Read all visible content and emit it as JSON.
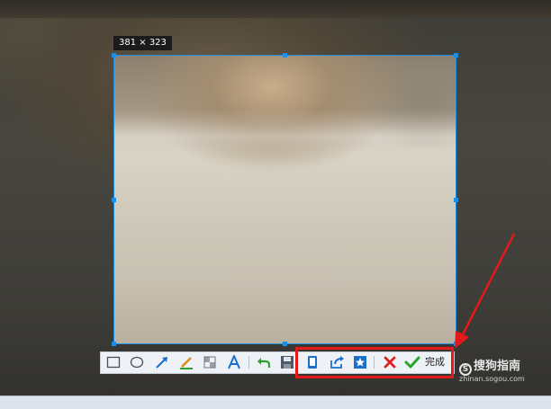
{
  "selection": {
    "size_label": "381 × 323"
  },
  "toolbar": {
    "tools": [
      {
        "name": "rectangle-tool",
        "icon": "rectangle-icon"
      },
      {
        "name": "ellipse-tool",
        "icon": "ellipse-icon"
      },
      {
        "name": "arrow-tool",
        "icon": "arrow-icon"
      },
      {
        "name": "pen-tool",
        "icon": "pen-icon"
      },
      {
        "name": "mosaic-tool",
        "icon": "mosaic-icon"
      },
      {
        "name": "text-tool",
        "icon": "text-a-icon"
      },
      {
        "name": "undo-button",
        "icon": "undo-icon"
      },
      {
        "name": "save-button",
        "icon": "save-icon"
      },
      {
        "name": "pin-to-screen-button",
        "icon": "phone-icon"
      },
      {
        "name": "share-button",
        "icon": "share-icon"
      },
      {
        "name": "favorite-button",
        "icon": "star-icon"
      },
      {
        "name": "cancel-button",
        "icon": "close-icon"
      }
    ],
    "done_label": "完成"
  },
  "watermark": {
    "brand": "搜狗指南",
    "url": "zhinan.sogou.com"
  },
  "colors": {
    "selection": "#1e8fe6",
    "highlight": "#e4191b",
    "cancel": "#e02020",
    "confirm": "#2aa42a"
  }
}
